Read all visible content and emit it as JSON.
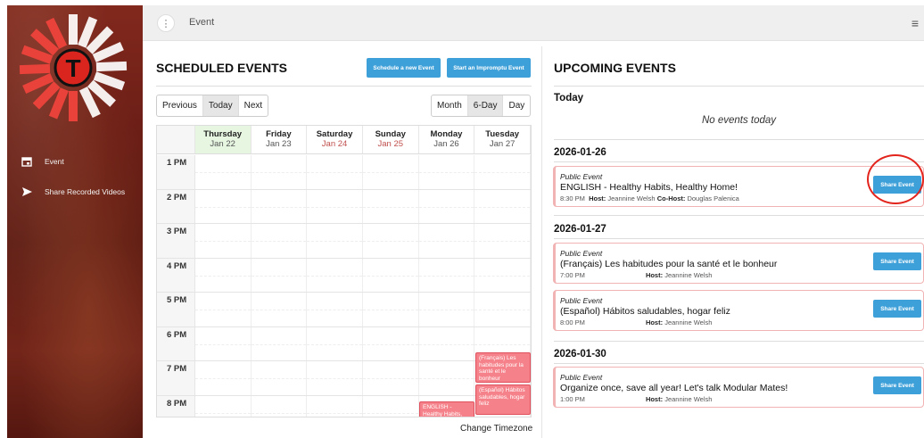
{
  "sidebar": {
    "items": [
      {
        "label": "Event",
        "icon": "calendar-icon"
      },
      {
        "label": "Share Recorded Videos",
        "icon": "send-icon"
      }
    ],
    "logo_letter": "T"
  },
  "topbar": {
    "breadcrumb": "Event",
    "menu_icon": "hamburger-icon"
  },
  "scheduled": {
    "title": "SCHEDULED EVENTS",
    "schedule_button": "Schedule a new Event",
    "impromptu_button": "Start an Impromptu Event",
    "nav": [
      "Previous",
      "Today",
      "Next"
    ],
    "views": [
      "Month",
      "6-Day",
      "Day"
    ],
    "days": [
      {
        "name": "Thursday",
        "date": "Jan 22"
      },
      {
        "name": "Friday",
        "date": "Jan 23"
      },
      {
        "name": "Saturday",
        "date": "Jan 24"
      },
      {
        "name": "Sunday",
        "date": "Jan 25"
      },
      {
        "name": "Monday",
        "date": "Jan 26"
      },
      {
        "name": "Tuesday",
        "date": "Jan 27"
      }
    ],
    "hours": [
      "1 PM",
      "2 PM",
      "3 PM",
      "4 PM",
      "5 PM",
      "6 PM",
      "7 PM",
      "8 PM"
    ],
    "events": [
      {
        "text": "(Français) Les habitudes pour la santé et le bonheur"
      },
      {
        "text": "(Español) Hábitos saludables, hogar feliz"
      },
      {
        "text": "ENGLISH - Healthy Habits, Healthy Home!"
      }
    ],
    "timezone_link": "Change Timezone"
  },
  "upcoming": {
    "title": "UPCOMING EVENTS",
    "today_label": "Today",
    "no_events": "No events today",
    "share_label": "Share Event",
    "groups": [
      {
        "date": "2026-01-26",
        "events": [
          {
            "kind": "Public Event",
            "title": "ENGLISH - Healthy Habits, Healthy Home!",
            "time": "8:30 PM",
            "host_label": "Host:",
            "host": "Jeannine Welsh",
            "cohost_label": "Co-Host:",
            "cohost": "Douglas Palenica"
          }
        ]
      },
      {
        "date": "2026-01-27",
        "events": [
          {
            "kind": "Public Event",
            "title": "(Français) Les habitudes pour la santé et le bonheur",
            "time": "7:00 PM",
            "host_label": "Host:",
            "host": "Jeannine Welsh"
          },
          {
            "kind": "Public Event",
            "title": "(Español) Hábitos saludables, hogar feliz",
            "time": "8:00 PM",
            "host_label": "Host:",
            "host": "Jeannine Welsh"
          }
        ]
      },
      {
        "date": "2026-01-30",
        "events": [
          {
            "kind": "Public Event",
            "title": "Organize once, save all year! Let's talk Modular Mates!",
            "time": "1:00 PM",
            "host_label": "Host:",
            "host": "Jeannine Welsh"
          }
        ]
      }
    ]
  },
  "colors": {
    "accent": "#3ea0d9",
    "event_fill": "#f5828a",
    "today_col": "#e6f6e1",
    "highlight_circle": "#e3241c"
  }
}
